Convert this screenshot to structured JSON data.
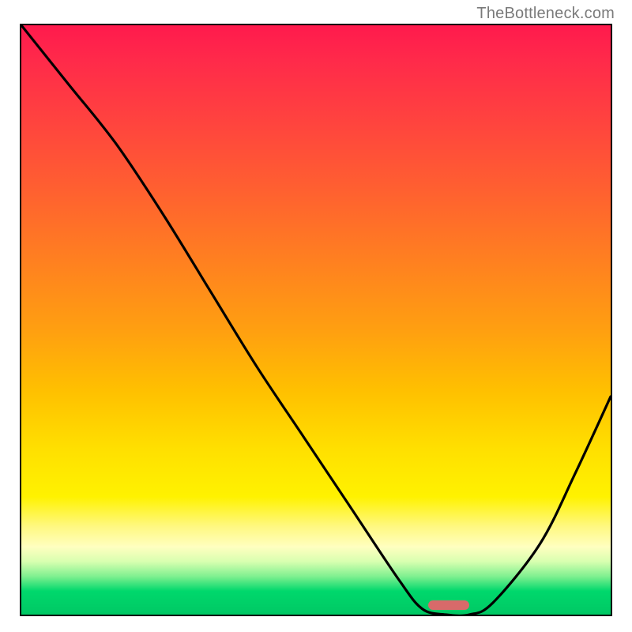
{
  "watermark": "TheBottleneck.com",
  "colors": {
    "marker": "#d86a6a",
    "curve": "#000000",
    "frame": "#000000"
  },
  "chart_data": {
    "type": "line",
    "title": "",
    "xlabel": "",
    "ylabel": "",
    "xlim": [
      0,
      100
    ],
    "ylim": [
      0,
      100
    ],
    "grid": false,
    "series": [
      {
        "name": "bottleneck-curve",
        "x": [
          0,
          8,
          16,
          24,
          32,
          40,
          48,
          56,
          64,
          68,
          72,
          76,
          80,
          88,
          94,
          100
        ],
        "y": [
          100,
          90,
          80,
          68,
          55,
          42,
          30,
          18,
          6,
          1,
          0,
          0,
          2,
          12,
          24,
          37
        ]
      }
    ],
    "marker": {
      "x_start": 69,
      "x_end": 76,
      "y": 0
    }
  }
}
